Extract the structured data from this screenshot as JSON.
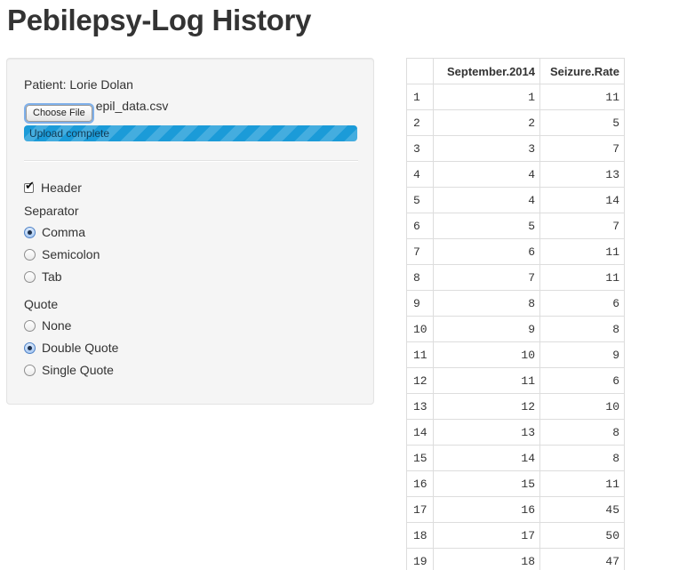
{
  "page": {
    "title": "Pebilepsy-Log History"
  },
  "sidebar": {
    "patient_label": "Patient: Lorie Dolan",
    "file_input": {
      "button_label": "Choose File",
      "file_name": "epil_data.csv"
    },
    "progress": {
      "label": "Upload complete",
      "value_percent": 100,
      "color": "#1b9bd8"
    },
    "header_checkbox": {
      "label": "Header",
      "checked": true
    },
    "separator": {
      "label": "Separator",
      "options": [
        "Comma",
        "Semicolon",
        "Tab"
      ],
      "selected": "Comma"
    },
    "quote": {
      "label": "Quote",
      "options": [
        "None",
        "Double Quote",
        "Single Quote"
      ],
      "selected": "Double Quote"
    }
  },
  "table": {
    "columns": [
      "",
      "September.2014",
      "Seizure.Rate"
    ],
    "rows": [
      [
        "1",
        "1",
        "11"
      ],
      [
        "2",
        "2",
        "5"
      ],
      [
        "3",
        "3",
        "7"
      ],
      [
        "4",
        "4",
        "13"
      ],
      [
        "5",
        "4",
        "14"
      ],
      [
        "6",
        "5",
        "7"
      ],
      [
        "7",
        "6",
        "11"
      ],
      [
        "8",
        "7",
        "11"
      ],
      [
        "9",
        "8",
        "6"
      ],
      [
        "10",
        "9",
        "8"
      ],
      [
        "11",
        "10",
        "9"
      ],
      [
        "12",
        "11",
        "6"
      ],
      [
        "13",
        "12",
        "10"
      ],
      [
        "14",
        "13",
        "8"
      ],
      [
        "15",
        "14",
        "8"
      ],
      [
        "16",
        "15",
        "11"
      ],
      [
        "17",
        "16",
        "45"
      ],
      [
        "18",
        "17",
        "50"
      ],
      [
        "19",
        "18",
        "47"
      ]
    ]
  }
}
